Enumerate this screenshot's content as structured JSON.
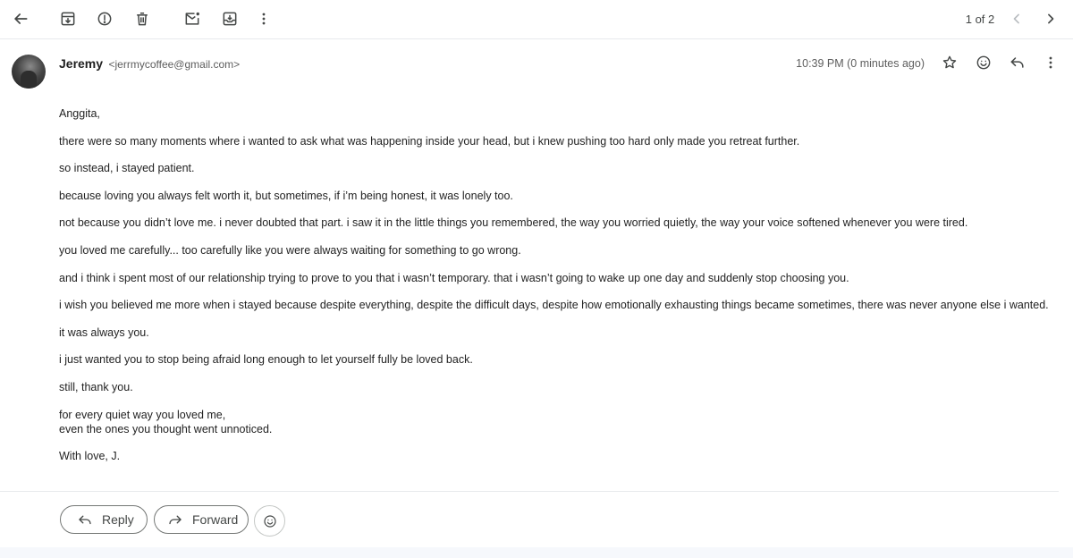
{
  "toolbar": {
    "icons": [
      "back-arrow-icon",
      "archive-icon",
      "report-spam-icon",
      "delete-icon",
      "mark-unread-icon",
      "move-to-icon",
      "more-vert-icon"
    ],
    "pager": "1 of 2"
  },
  "message": {
    "sender_name": "Jeremy",
    "sender_email": "<jerrmycoffee@gmail.com>",
    "time": "10:39 PM (0 minutes ago)",
    "paragraphs": [
      "Anggita,",
      "there were so many moments where i wanted to ask what was happening inside your head, but i knew pushing too hard only made you retreat further.",
      "so instead, i stayed patient.",
      "because loving you always felt worth it, but sometimes, if i’m being honest, it was lonely too.",
      "not because you didn’t love me. i never doubted that part. i saw it in the little things you remembered, the way you worried quietly, the way your voice softened whenever you were tired.",
      "you loved me carefully... too carefully like you were always waiting for something to go wrong.",
      "and i think i spent most of our relationship trying to prove to you that i wasn’t temporary. that i wasn’t going to wake up one day and suddenly stop choosing you.",
      "i wish you believed me more when i stayed because despite everything, despite the difficult days, despite how emotionally exhausting things became sometimes, there was never anyone else i wanted.",
      "it was always you.",
      "i just wanted you to stop being afraid long enough to let yourself fully be loved back.",
      "still, thank you.",
      "for every quiet way you loved me,\neven the ones you thought went unnoticed.",
      "With love, J."
    ]
  },
  "actions": {
    "reply_label": "Reply",
    "forward_label": "Forward"
  },
  "colors": {
    "text": "#1f1f1f",
    "muted": "#5e5e5e",
    "icon": "#444746",
    "border": "#747775"
  }
}
